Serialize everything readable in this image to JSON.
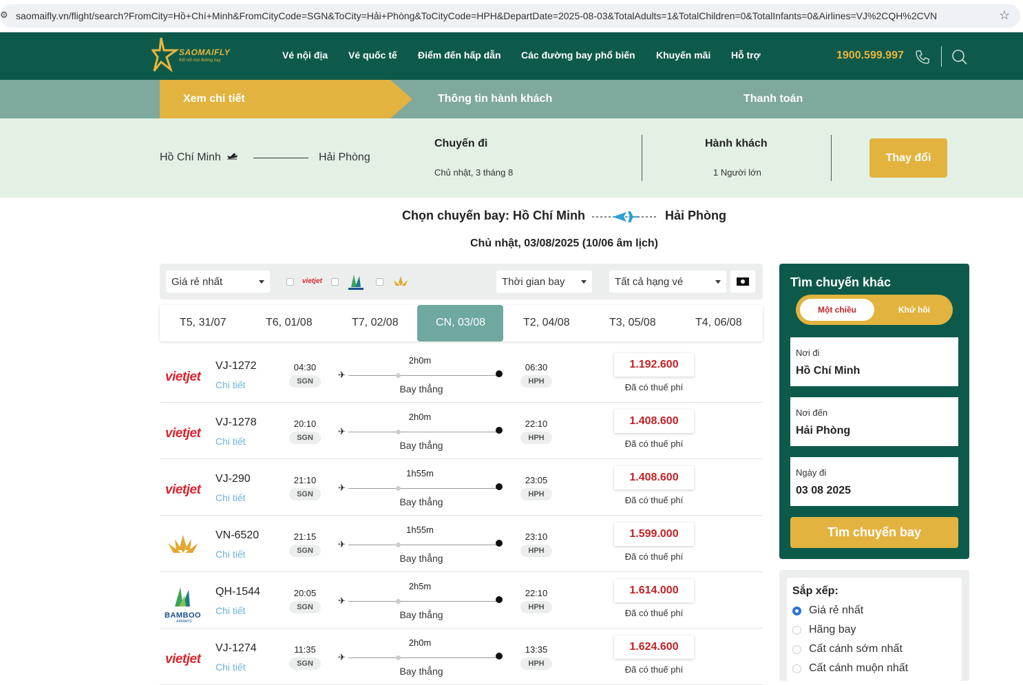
{
  "browser": {
    "url": "saomaifly.vn/flight/search?FromCity=Hồ+Chí+Minh&FromCityCode=SGN&ToCity=Hải+Phòng&ToCityCode=HPH&DepartDate=2025-08-03&TotalAdults=1&TotalChildren=0&TotalInfants=0&Airlines=VJ%2CQH%2CVN"
  },
  "header": {
    "logo_text": "SAOMAIFLY",
    "logo_tagline": "Kết nối mọi đường bay",
    "nav": [
      "Vé nội địa",
      "Vé quốc tế",
      "Điểm đến hấp dẫn",
      "Các đường bay phổ biến",
      "Khuyến mãi",
      "Hỗ trợ"
    ],
    "phone": "1900.599.997"
  },
  "steps": [
    "Xem chi tiết",
    "Thông tin hành khách",
    "Thanh toán"
  ],
  "summary": {
    "from": "Hồ Chí Minh",
    "to": "Hải Phòng",
    "trip_label": "Chuyến đi",
    "trip_date": "Chủ nhật, 3 tháng 8",
    "pax_label": "Hành khách",
    "pax_value": "1 Người lớn",
    "change_button": "Thay đổi"
  },
  "route": {
    "prefix": "Chọn chuyến bay: Hồ Chí Minh",
    "to": "Hải Phòng",
    "date": "Chủ nhật, 03/08/2025 (10/06 âm lịch)"
  },
  "filters": {
    "sort_select": "Giá rẻ nhất",
    "time_select": "Thời gian bay",
    "class_select": "Tất cả hạng vé"
  },
  "dates": [
    "T5, 31/07",
    "T6, 01/08",
    "T7, 02/08",
    "CN, 03/08",
    "T2, 04/08",
    "T3, 05/08",
    "T4, 06/08"
  ],
  "flights": [
    {
      "airline": "vietjet",
      "no": "VJ-1272",
      "detail": "Chi tiết",
      "dep": "04:30",
      "from": "SGN",
      "dur": "2h0m",
      "type": "Bay thẳng",
      "arr": "06:30",
      "to": "HPH",
      "price": "1.192.600",
      "tax": "Đã có thuế phí"
    },
    {
      "airline": "vietjet",
      "no": "VJ-1278",
      "detail": "Chi tiết",
      "dep": "20:10",
      "from": "SGN",
      "dur": "2h0m",
      "type": "Bay thẳng",
      "arr": "22:10",
      "to": "HPH",
      "price": "1.408.600",
      "tax": "Đã có thuế phí"
    },
    {
      "airline": "vietjet",
      "no": "VJ-290",
      "detail": "Chi tiết",
      "dep": "21:10",
      "from": "SGN",
      "dur": "1h55m",
      "type": "Bay thẳng",
      "arr": "23:05",
      "to": "HPH",
      "price": "1.408.600",
      "tax": "Đã có thuế phí"
    },
    {
      "airline": "vietnam",
      "no": "VN-6520",
      "detail": "Chi tiết",
      "dep": "21:15",
      "from": "SGN",
      "dur": "1h55m",
      "type": "Bay thẳng",
      "arr": "23:10",
      "to": "HPH",
      "price": "1.599.000",
      "tax": "Đã có thuế phí"
    },
    {
      "airline": "bamboo",
      "no": "QH-1544",
      "detail": "Chi tiết",
      "dep": "20:05",
      "from": "SGN",
      "dur": "2h5m",
      "type": "Bay thẳng",
      "arr": "22:10",
      "to": "HPH",
      "price": "1.614.000",
      "tax": "Đã có thuế phí"
    },
    {
      "airline": "vietjet",
      "no": "VJ-1274",
      "detail": "Chi tiết",
      "dep": "11:35",
      "from": "SGN",
      "dur": "2h0m",
      "type": "Bay thẳng",
      "arr": "13:35",
      "to": "HPH",
      "price": "1.624.600",
      "tax": "Đã có thuế phí"
    }
  ],
  "airline_logos": {
    "vietjet": "vietjet",
    "bamboo": "BAMBOO",
    "bamboo_sub": "AIRWAYS"
  },
  "panel": {
    "title": "Tìm chuyến khác",
    "oneway": "Một chiều",
    "roundtrip": "Khứ hồi",
    "from_label": "Nơi đi",
    "from_value": "Hồ Chí Minh",
    "to_label": "Nơi đến",
    "to_value": "Hải Phòng",
    "date_label": "Ngày đi",
    "date_value": "03 08 2025",
    "search_button": "Tìm chuyến bay"
  },
  "sort": {
    "title": "Sắp xếp:",
    "options": [
      "Giá rẻ nhất",
      "Hãng bay",
      "Cất cánh sớm nhất",
      "Cất cánh muộn nhất"
    ],
    "selected_index": 0
  },
  "colors": {
    "brand_green": "#0e5a4a",
    "accent_gold": "#e3b33f",
    "price_red": "#c32126"
  }
}
